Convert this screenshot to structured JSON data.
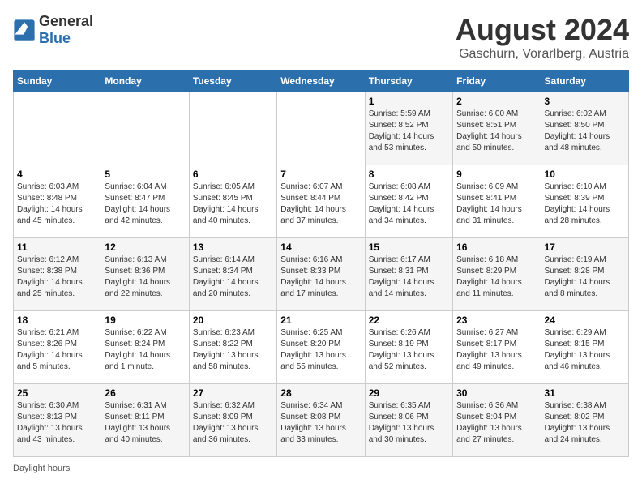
{
  "header": {
    "logo_general": "General",
    "logo_blue": "Blue",
    "title": "August 2024",
    "subtitle": "Gaschurn, Vorarlberg, Austria"
  },
  "days_of_week": [
    "Sunday",
    "Monday",
    "Tuesday",
    "Wednesday",
    "Thursday",
    "Friday",
    "Saturday"
  ],
  "weeks": [
    [
      {
        "num": "",
        "sunrise": "",
        "sunset": "",
        "daylight": ""
      },
      {
        "num": "",
        "sunrise": "",
        "sunset": "",
        "daylight": ""
      },
      {
        "num": "",
        "sunrise": "",
        "sunset": "",
        "daylight": ""
      },
      {
        "num": "",
        "sunrise": "",
        "sunset": "",
        "daylight": ""
      },
      {
        "num": "1",
        "sunrise": "Sunrise: 5:59 AM",
        "sunset": "Sunset: 8:52 PM",
        "daylight": "Daylight: 14 hours and 53 minutes."
      },
      {
        "num": "2",
        "sunrise": "Sunrise: 6:00 AM",
        "sunset": "Sunset: 8:51 PM",
        "daylight": "Daylight: 14 hours and 50 minutes."
      },
      {
        "num": "3",
        "sunrise": "Sunrise: 6:02 AM",
        "sunset": "Sunset: 8:50 PM",
        "daylight": "Daylight: 14 hours and 48 minutes."
      }
    ],
    [
      {
        "num": "4",
        "sunrise": "Sunrise: 6:03 AM",
        "sunset": "Sunset: 8:48 PM",
        "daylight": "Daylight: 14 hours and 45 minutes."
      },
      {
        "num": "5",
        "sunrise": "Sunrise: 6:04 AM",
        "sunset": "Sunset: 8:47 PM",
        "daylight": "Daylight: 14 hours and 42 minutes."
      },
      {
        "num": "6",
        "sunrise": "Sunrise: 6:05 AM",
        "sunset": "Sunset: 8:45 PM",
        "daylight": "Daylight: 14 hours and 40 minutes."
      },
      {
        "num": "7",
        "sunrise": "Sunrise: 6:07 AM",
        "sunset": "Sunset: 8:44 PM",
        "daylight": "Daylight: 14 hours and 37 minutes."
      },
      {
        "num": "8",
        "sunrise": "Sunrise: 6:08 AM",
        "sunset": "Sunset: 8:42 PM",
        "daylight": "Daylight: 14 hours and 34 minutes."
      },
      {
        "num": "9",
        "sunrise": "Sunrise: 6:09 AM",
        "sunset": "Sunset: 8:41 PM",
        "daylight": "Daylight: 14 hours and 31 minutes."
      },
      {
        "num": "10",
        "sunrise": "Sunrise: 6:10 AM",
        "sunset": "Sunset: 8:39 PM",
        "daylight": "Daylight: 14 hours and 28 minutes."
      }
    ],
    [
      {
        "num": "11",
        "sunrise": "Sunrise: 6:12 AM",
        "sunset": "Sunset: 8:38 PM",
        "daylight": "Daylight: 14 hours and 25 minutes."
      },
      {
        "num": "12",
        "sunrise": "Sunrise: 6:13 AM",
        "sunset": "Sunset: 8:36 PM",
        "daylight": "Daylight: 14 hours and 22 minutes."
      },
      {
        "num": "13",
        "sunrise": "Sunrise: 6:14 AM",
        "sunset": "Sunset: 8:34 PM",
        "daylight": "Daylight: 14 hours and 20 minutes."
      },
      {
        "num": "14",
        "sunrise": "Sunrise: 6:16 AM",
        "sunset": "Sunset: 8:33 PM",
        "daylight": "Daylight: 14 hours and 17 minutes."
      },
      {
        "num": "15",
        "sunrise": "Sunrise: 6:17 AM",
        "sunset": "Sunset: 8:31 PM",
        "daylight": "Daylight: 14 hours and 14 minutes."
      },
      {
        "num": "16",
        "sunrise": "Sunrise: 6:18 AM",
        "sunset": "Sunset: 8:29 PM",
        "daylight": "Daylight: 14 hours and 11 minutes."
      },
      {
        "num": "17",
        "sunrise": "Sunrise: 6:19 AM",
        "sunset": "Sunset: 8:28 PM",
        "daylight": "Daylight: 14 hours and 8 minutes."
      }
    ],
    [
      {
        "num": "18",
        "sunrise": "Sunrise: 6:21 AM",
        "sunset": "Sunset: 8:26 PM",
        "daylight": "Daylight: 14 hours and 5 minutes."
      },
      {
        "num": "19",
        "sunrise": "Sunrise: 6:22 AM",
        "sunset": "Sunset: 8:24 PM",
        "daylight": "Daylight: 14 hours and 1 minute."
      },
      {
        "num": "20",
        "sunrise": "Sunrise: 6:23 AM",
        "sunset": "Sunset: 8:22 PM",
        "daylight": "Daylight: 13 hours and 58 minutes."
      },
      {
        "num": "21",
        "sunrise": "Sunrise: 6:25 AM",
        "sunset": "Sunset: 8:20 PM",
        "daylight": "Daylight: 13 hours and 55 minutes."
      },
      {
        "num": "22",
        "sunrise": "Sunrise: 6:26 AM",
        "sunset": "Sunset: 8:19 PM",
        "daylight": "Daylight: 13 hours and 52 minutes."
      },
      {
        "num": "23",
        "sunrise": "Sunrise: 6:27 AM",
        "sunset": "Sunset: 8:17 PM",
        "daylight": "Daylight: 13 hours and 49 minutes."
      },
      {
        "num": "24",
        "sunrise": "Sunrise: 6:29 AM",
        "sunset": "Sunset: 8:15 PM",
        "daylight": "Daylight: 13 hours and 46 minutes."
      }
    ],
    [
      {
        "num": "25",
        "sunrise": "Sunrise: 6:30 AM",
        "sunset": "Sunset: 8:13 PM",
        "daylight": "Daylight: 13 hours and 43 minutes."
      },
      {
        "num": "26",
        "sunrise": "Sunrise: 6:31 AM",
        "sunset": "Sunset: 8:11 PM",
        "daylight": "Daylight: 13 hours and 40 minutes."
      },
      {
        "num": "27",
        "sunrise": "Sunrise: 6:32 AM",
        "sunset": "Sunset: 8:09 PM",
        "daylight": "Daylight: 13 hours and 36 minutes."
      },
      {
        "num": "28",
        "sunrise": "Sunrise: 6:34 AM",
        "sunset": "Sunset: 8:08 PM",
        "daylight": "Daylight: 13 hours and 33 minutes."
      },
      {
        "num": "29",
        "sunrise": "Sunrise: 6:35 AM",
        "sunset": "Sunset: 8:06 PM",
        "daylight": "Daylight: 13 hours and 30 minutes."
      },
      {
        "num": "30",
        "sunrise": "Sunrise: 6:36 AM",
        "sunset": "Sunset: 8:04 PM",
        "daylight": "Daylight: 13 hours and 27 minutes."
      },
      {
        "num": "31",
        "sunrise": "Sunrise: 6:38 AM",
        "sunset": "Sunset: 8:02 PM",
        "daylight": "Daylight: 13 hours and 24 minutes."
      }
    ]
  ],
  "footer": {
    "text": "Daylight hours"
  }
}
